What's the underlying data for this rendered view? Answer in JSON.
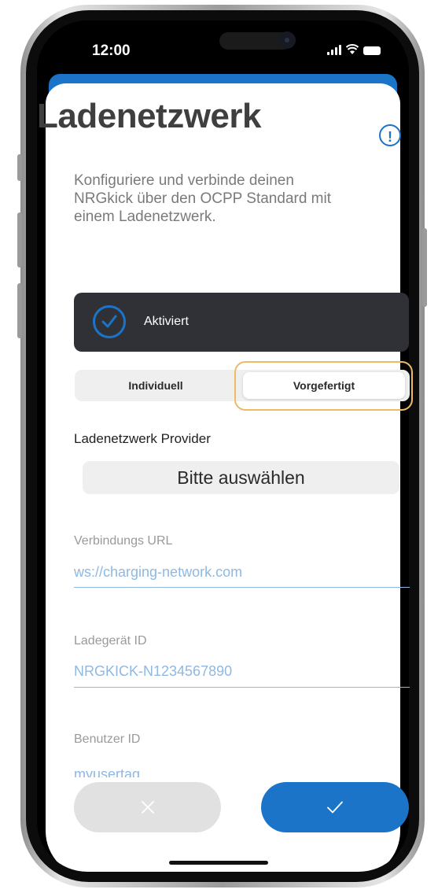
{
  "status_bar": {
    "time": "12:00"
  },
  "header": {
    "title": "Ladenetzwerk",
    "info_icon": "info-circle-icon",
    "description": "Konfiguriere und verbinde deinen NRGkick über den OCPP Standard mit einem Ladenetzwerk."
  },
  "activation": {
    "label": "Aktiviert",
    "checked": true,
    "icon": "check-circle-icon"
  },
  "mode_tabs": [
    {
      "label": "Individuell",
      "selected": false
    },
    {
      "label": "Vorgefertigt",
      "selected": true
    }
  ],
  "provider": {
    "label": "Ladenetzwerk Provider",
    "select_value": "Bitte auswählen"
  },
  "fields": [
    {
      "label": "Verbindungs URL",
      "value": "ws://charging-network.com"
    },
    {
      "label": "Ladegerät ID",
      "value": "NRGKICK-N1234567890"
    },
    {
      "label": "Benutzer ID",
      "value": "myusertag"
    }
  ],
  "actions": {
    "cancel_icon": "close-icon",
    "confirm_icon": "checkmark-icon"
  },
  "colors": {
    "accent": "#1b74c8",
    "highlight": "#f1b964",
    "card": "#2f3137",
    "field_value": "#8fb8e2"
  }
}
